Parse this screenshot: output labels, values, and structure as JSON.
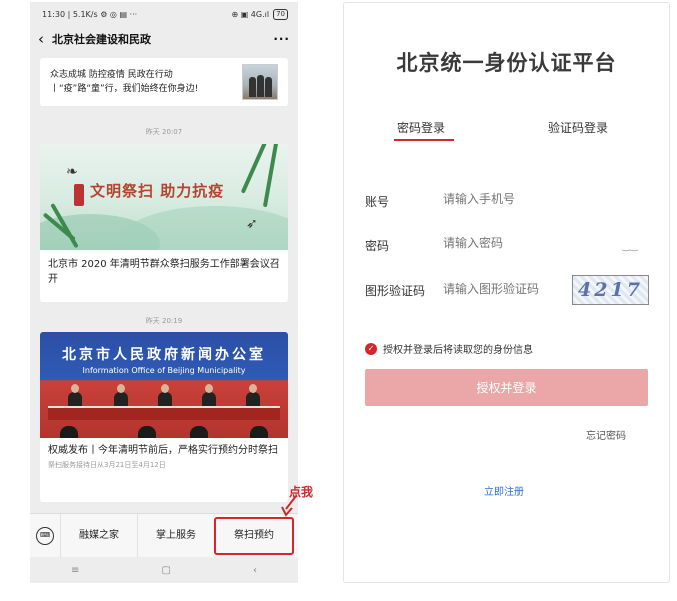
{
  "left_phone": {
    "status": {
      "time_net": "11:30 | 5.1K/s ⚙ ◎ ▤ ···",
      "signal": "⊕ ▣ 4G.ıl",
      "battery": "70"
    },
    "header": {
      "back": "‹",
      "title": "北京社会建设和民政",
      "more": "···"
    },
    "article1": {
      "text": "众志成城 防控疫情 民政在行动丨“疫”路“童”行，我们始终在你身边!"
    },
    "timestamp1": "昨天 20:07",
    "article2": {
      "banner_text": "文明祭扫 助力抗疫",
      "caption": "北京市 2020 年清明节群众祭扫服务工作部署会议召开"
    },
    "timestamp2": "昨天 20:19",
    "article3": {
      "banner_cn": "北京市人民政府新闻办公室",
      "banner_en": "Information Office of Beijing Municipality",
      "caption": "权威发布丨今年清明节前后，严格实行预约分时祭扫",
      "sub": "祭扫服务接待日从3月21日至4月12日"
    },
    "menu": {
      "keyboard": "⌨",
      "items": [
        "融媒之家",
        "掌上服务",
        "祭扫预约"
      ]
    },
    "nav": [
      "≡",
      "▢",
      "‹"
    ]
  },
  "annotation": {
    "label": "点我"
  },
  "right_phone": {
    "title": "北京统一身份认证平台",
    "tabs": [
      "密码登录",
      "验证码登录"
    ],
    "fields": {
      "account_label": "账号",
      "account_placeholder": "请输入手机号",
      "password_label": "密码",
      "password_placeholder": "请输入密码",
      "captcha_label": "图形验证码",
      "captcha_placeholder": "请输入图形验证码",
      "captcha_text": "4217"
    },
    "eye_icon": "‿‿",
    "check_icon": "✓",
    "consent": "授权并登录后将读取您的身份信息",
    "submit": "授权并登录",
    "forgot": "忘记密码",
    "register": "立即注册"
  },
  "colors": {
    "accent": "#d6262b",
    "submit_bg": "#eba7a7",
    "link": "#2b6fd6"
  }
}
